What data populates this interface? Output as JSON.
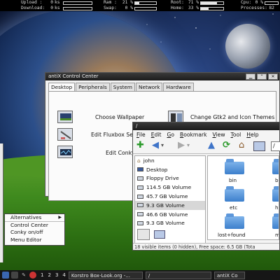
{
  "conky": {
    "upload_label": "Upload :",
    "upload_val": "0",
    "upload_unit": "ks",
    "download_label": "Download:",
    "download_val": "0",
    "download_unit": "ks",
    "ram_label": "Ram :",
    "ram_val": "21 %",
    "ram_level": 0.21,
    "swap_label": "Swap:",
    "swap_val": "0 %",
    "swap_level": 0.0,
    "root_label": "Root:",
    "root_val": "71 %",
    "root_level": 0.71,
    "home_label": "Home:",
    "home_val": "33 %",
    "home_level": 0.33,
    "cpu_label": "Cpu:",
    "cpu_val": "0 %",
    "cpu_level": 0.0,
    "proc_label": "Processes:",
    "proc_val": "82"
  },
  "control_center": {
    "title": "antiX Control Center",
    "tabs": [
      "Desktop",
      "Peripherals",
      "System",
      "Network",
      "Hardware"
    ],
    "items": [
      {
        "label": "Choose Wallpaper",
        "icon": "wallpaper-icon"
      },
      {
        "label": "Change Gtk2 and Icon Themes",
        "icon": "theme-icon"
      },
      {
        "label": "Edit Fluxbox Se",
        "icon": "fluxbox-settings-icon"
      },
      {
        "label": "Edit Conky",
        "icon": "conky-icon"
      }
    ]
  },
  "file_manager": {
    "title": "/",
    "menu": [
      "File",
      "Edit",
      "Go",
      "Bookmark",
      "View",
      "Tool",
      "Help"
    ],
    "path": "/",
    "places": [
      {
        "label": "john",
        "type": "home"
      },
      {
        "label": "Desktop",
        "type": "desktop"
      },
      {
        "label": "Floppy Drive",
        "type": "floppy"
      },
      {
        "label": "114.5 GB Volume",
        "type": "drive"
      },
      {
        "label": "45.7 GB Volume",
        "type": "drive"
      },
      {
        "label": "9.3 GB Volume",
        "type": "drive",
        "selected": true
      },
      {
        "label": "46.6 GB Volume",
        "type": "drive"
      },
      {
        "label": "9.3 GB Volume",
        "type": "drive"
      }
    ],
    "files": [
      "bin",
      "b",
      "etc",
      "h",
      "lost+found",
      "m"
    ],
    "status": "18 visible items (0 hidden), Free space: 6.5 GB (Tota"
  },
  "menu": {
    "items": [
      "Alternatives",
      "Control Center",
      "Conky on/off",
      "Menu Editor"
    ]
  },
  "taskbar": {
    "desktops": [
      "1",
      "2",
      "3",
      "4"
    ],
    "task1": "Korstro Box-Look.org -...",
    "task2": "/",
    "task3": "antiX Co"
  }
}
